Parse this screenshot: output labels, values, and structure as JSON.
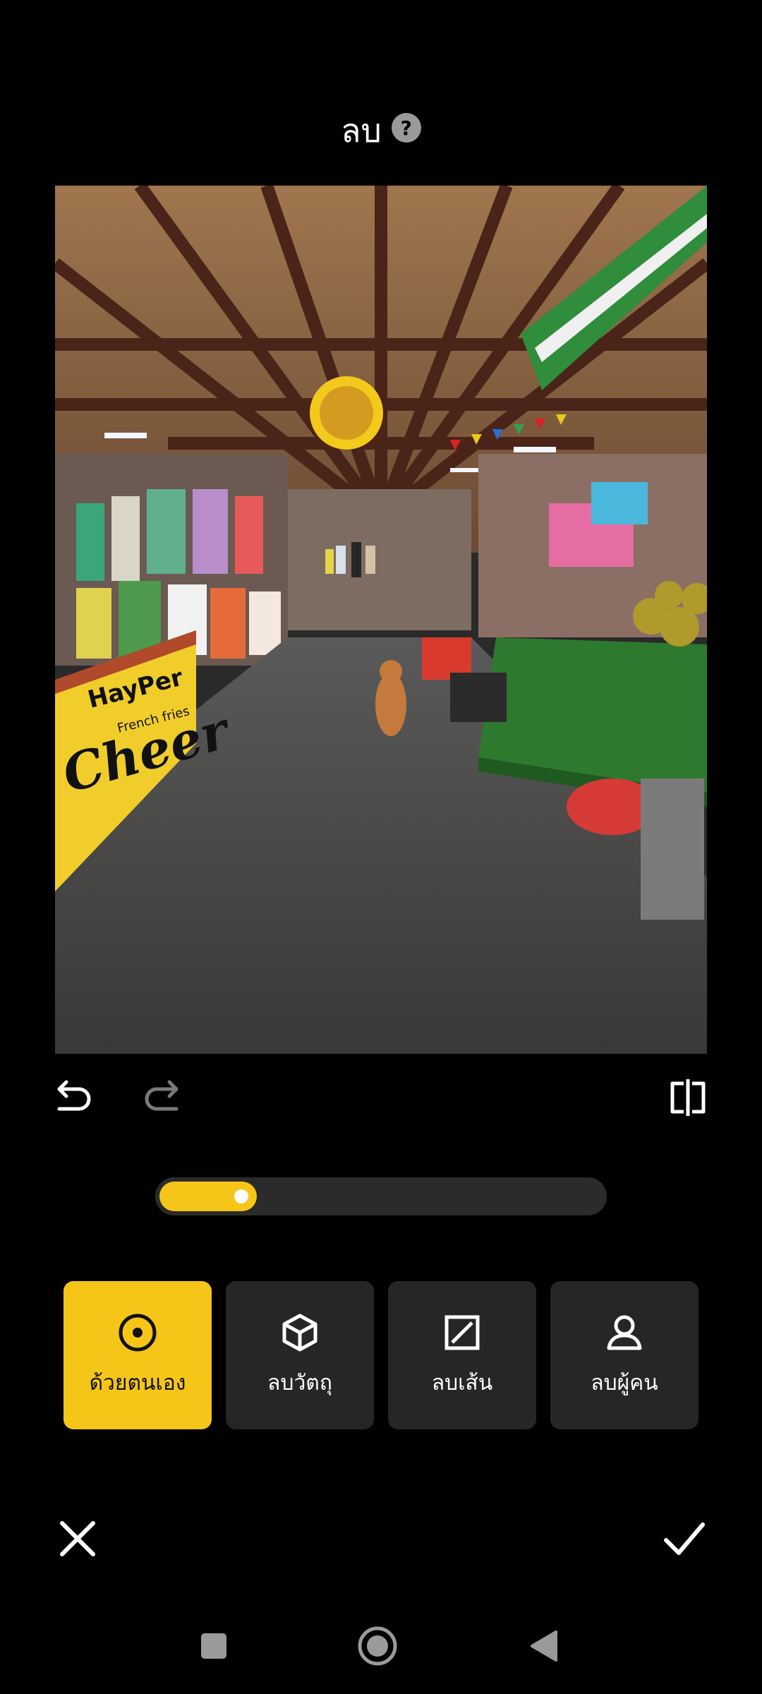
{
  "header": {
    "title": "ลบ",
    "help_icon": "question-circle-icon",
    "help_glyph": "?"
  },
  "photo": {
    "description_icon": "market-photo",
    "sign_text": "HayPer",
    "sign_subtext": "French fries",
    "sign_script": "Cheer"
  },
  "toolbar": {
    "undo_icon": "undo-icon",
    "redo_icon": "redo-icon",
    "compare_icon": "compare-icon"
  },
  "brush_size": {
    "fraction": 0.22,
    "fill_color": "#f5c518"
  },
  "modes": [
    {
      "label": "ด้วยตนเอง",
      "icon": "target-icon",
      "active": true
    },
    {
      "label": "ลบวัตถุ",
      "icon": "cube-icon",
      "active": false
    },
    {
      "label": "ลบเส้น",
      "icon": "line-square-icon",
      "active": false
    },
    {
      "label": "ลบผู้คน",
      "icon": "person-icon",
      "active": false
    }
  ],
  "actions": {
    "cancel_icon": "close-icon",
    "confirm_icon": "check-icon"
  },
  "navigation": {
    "recent_icon": "square-icon",
    "home_icon": "circle-icon",
    "back_icon": "triangle-back-icon"
  },
  "colors": {
    "accent": "#f5c518",
    "tile": "#262626",
    "background": "#000000"
  }
}
